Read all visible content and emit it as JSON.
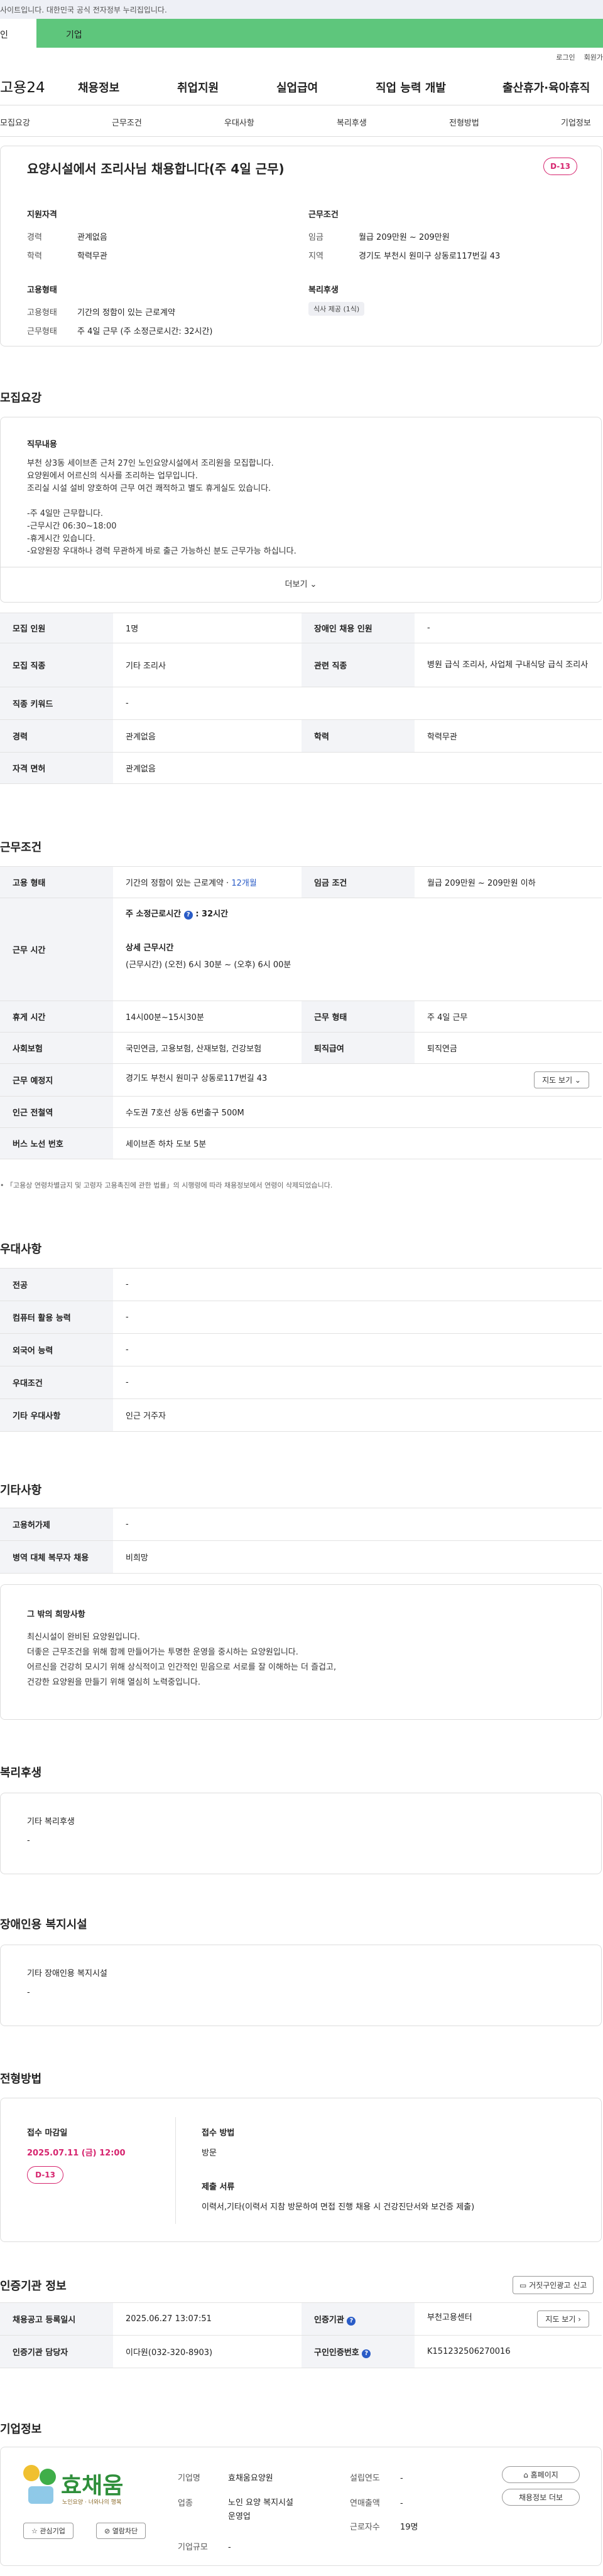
{
  "top_notice": "사이트입니다. 대한민국 공식 전자정부 누리집입니다.",
  "userbar": {
    "individual": "인",
    "business": "기업"
  },
  "util": {
    "login": "로그인",
    "join": "회원가"
  },
  "gnb": {
    "logo": "고용24",
    "menus": [
      "채용정보",
      "취업지원",
      "실업급여",
      "직업 능력 개발",
      "출산휴가·육아휴직"
    ]
  },
  "subtabs": [
    "모집요강",
    "근무조건",
    "우대사항",
    "복리후생",
    "전형방법",
    "기업정보"
  ],
  "header": {
    "title": "요양시설에서 조리사님 채용합니다(주 4일 근무)",
    "dday": "D-13",
    "qual_title": "지원자격",
    "qual_rows": [
      [
        "경력",
        "관계없음"
      ],
      [
        "학력",
        "학력무관"
      ]
    ],
    "cond_title": "근무조건",
    "cond_rows": [
      [
        "임금",
        "월급 209만원 ~ 209만원"
      ],
      [
        "지역",
        "경기도 부천시 원미구 상동로117번길 43"
      ]
    ],
    "emp_title": "고용형태",
    "emp_rows": [
      [
        "고용형태",
        "기간의 정함이 있는 근로계약"
      ],
      [
        "근무형태",
        "주 4일 근무 (주 소정근로시간: 32시간)"
      ]
    ],
    "welfare_title": "복리후생",
    "welfare_tag": "식사 제공 (1식)"
  },
  "recruit": {
    "section_title": "모집요강",
    "job_desc_title": "직무내용",
    "job_desc_lines": [
      "부천 상3동 세이브존 근처 27인 노인요양시설에서 조리원을 모집합니다.",
      "요양원에서 어르신의 식사를 조리하는 업무입니다.",
      "조리실 시설 설비 양호하여 근무 여건 쾌적하고 별도 휴게실도 있습니다.",
      "",
      "-주 4일만 근무합니다.",
      "-근무시간 06:30~18:00",
      "-휴게시간 있습니다.",
      "-요양원장 우대하나 경력 무관하게 바로 출근 가능하신 분도 근무가능 하십니다."
    ],
    "more": "더보기 ⌄",
    "rows": [
      [
        "모집 인원",
        "1명",
        "장애인 채용 인원",
        "-"
      ],
      [
        "모집 직종",
        "기타 조리사",
        "관련 직종",
        "병원 급식 조리사, 사업체 구내식당 급식 조리사"
      ],
      [
        "직종 키워드",
        "-",
        "",
        ""
      ],
      [
        "경력",
        "관계없음",
        "학력",
        "학력무관"
      ],
      [
        "자격 면허",
        "관계없음",
        "",
        ""
      ]
    ]
  },
  "work": {
    "section_title": "근무조건",
    "emp_type_label": "고용 형태",
    "emp_type_value": "기간의 정함이 있는 근로계약 · ",
    "emp_type_months": "12개월",
    "wage_label": "임금 조건",
    "wage_value": "월급 209만원 ~ 209만원 이하",
    "hours_label": "근무 시간",
    "weekly_hours_label": "주 소정근로시간",
    "weekly_hours_value": ": 32시간",
    "detail_hours_title": "상세 근무시간",
    "detail_hours_value": "(근무시간) (오전) 6시 30분 ~ (오후) 6시 00분",
    "rows": [
      [
        "휴게 시간",
        "14시00분~15시30분",
        "근무 형태",
        "주 4일 근무"
      ],
      [
        "사회보험",
        "국민연금, 고용보험, 산재보험, 건강보험",
        "퇴직급여",
        "퇴직연금"
      ]
    ],
    "location_label": "근무 예정지",
    "location_value": "경기도 부천시 원미구 상동로117번길 43",
    "map_button": "지도 보기 ⌄",
    "station_label": "인근 전철역",
    "station_value": "수도권 7호선 상동 6번출구 500M",
    "bus_label": "버스 노선 번호",
    "bus_value": "세이브존 하차 도보 5분",
    "footnote": "「고용상 연령차별금지 및 고령자 고용촉진에 관한 법률」의 시행령에 따라 채용정보에서 연령이 삭제되었습니다."
  },
  "pref": {
    "section_title": "우대사항",
    "rows": [
      [
        "전공",
        "-"
      ],
      [
        "컴퓨터 활용 능력",
        "-"
      ],
      [
        "외국어 능력",
        "-"
      ],
      [
        "우대조건",
        "-"
      ],
      [
        "기타 우대사항",
        "인근 거주자"
      ]
    ]
  },
  "etc": {
    "section_title": "기타사항",
    "rows": [
      [
        "고용허가제",
        "-"
      ],
      [
        "병역 대체 복무자 채용",
        "비희망"
      ]
    ],
    "other_title": "그 밖의 희망사항",
    "other_lines": [
      "최신시설이 완비된 요양원입니다.",
      "더좋은 근무조건을 위해 함께 만들어가는 투명한 운영을 중시하는 요양원입니다.",
      "어르신을 건강히 모시기 위해 상식적이고 인간적인 믿음으로 서로를 잘 이해하는 더 즐겁고,",
      "건강한 요양원을 만들기 위해 열심히 노력중입니다."
    ]
  },
  "benefit": {
    "section_title": "복리후생",
    "box_title": "기타 복리후생",
    "box_value": "-"
  },
  "disability": {
    "section_title": "장애인용 복지시설",
    "box_title": "기타 장애인용 복지시설",
    "box_value": "-"
  },
  "apply": {
    "section_title": "전형방법",
    "deadline_title": "접수 마감일",
    "deadline_value": "2025.07.11 (금) 12:00",
    "dday": "D-13",
    "method_title": "접수 방법",
    "method_value": "방문",
    "docs_title": "제출 서류",
    "docs_value": "이력서,기타(이력서 지참 방문하여 면접 진행 채용 시 건강진단서와 보건증 제출)"
  },
  "agency": {
    "section_title": "인증기관 정보",
    "report_button": "거짓구인광고 신고",
    "rows": [
      [
        "채용공고 등록일시",
        "2025.06.27 13:07:51",
        "인증기관",
        "부천고용센터"
      ],
      [
        "인증기관 담당자",
        "이다원(032-320-8903)",
        "구인인증번호",
        "K151232506270016"
      ]
    ],
    "map_button": "지도 보기 ›"
  },
  "company": {
    "section_title": "기업정보",
    "logo_text": "효채움",
    "logo_sub": "노인요양 · 너와나의 행복",
    "fav_button": "☆ 관심기업",
    "block_button": "⊘ 열람차단",
    "rows": [
      [
        "기업명",
        "효채움요양원",
        "설립연도",
        "-"
      ],
      [
        "업종",
        "노인 요양 복지시설 운영업",
        "연매출액",
        "-"
      ],
      [
        "기업규모",
        "-",
        "근로자수",
        "19명"
      ]
    ],
    "homepage_button": "홈페이지",
    "more_jobs_button": "채용정보 더보"
  },
  "colors": {
    "accent_green": "#5ec67c",
    "dday_pink": "#d6246e",
    "link_blue": "#2a5cc7"
  }
}
